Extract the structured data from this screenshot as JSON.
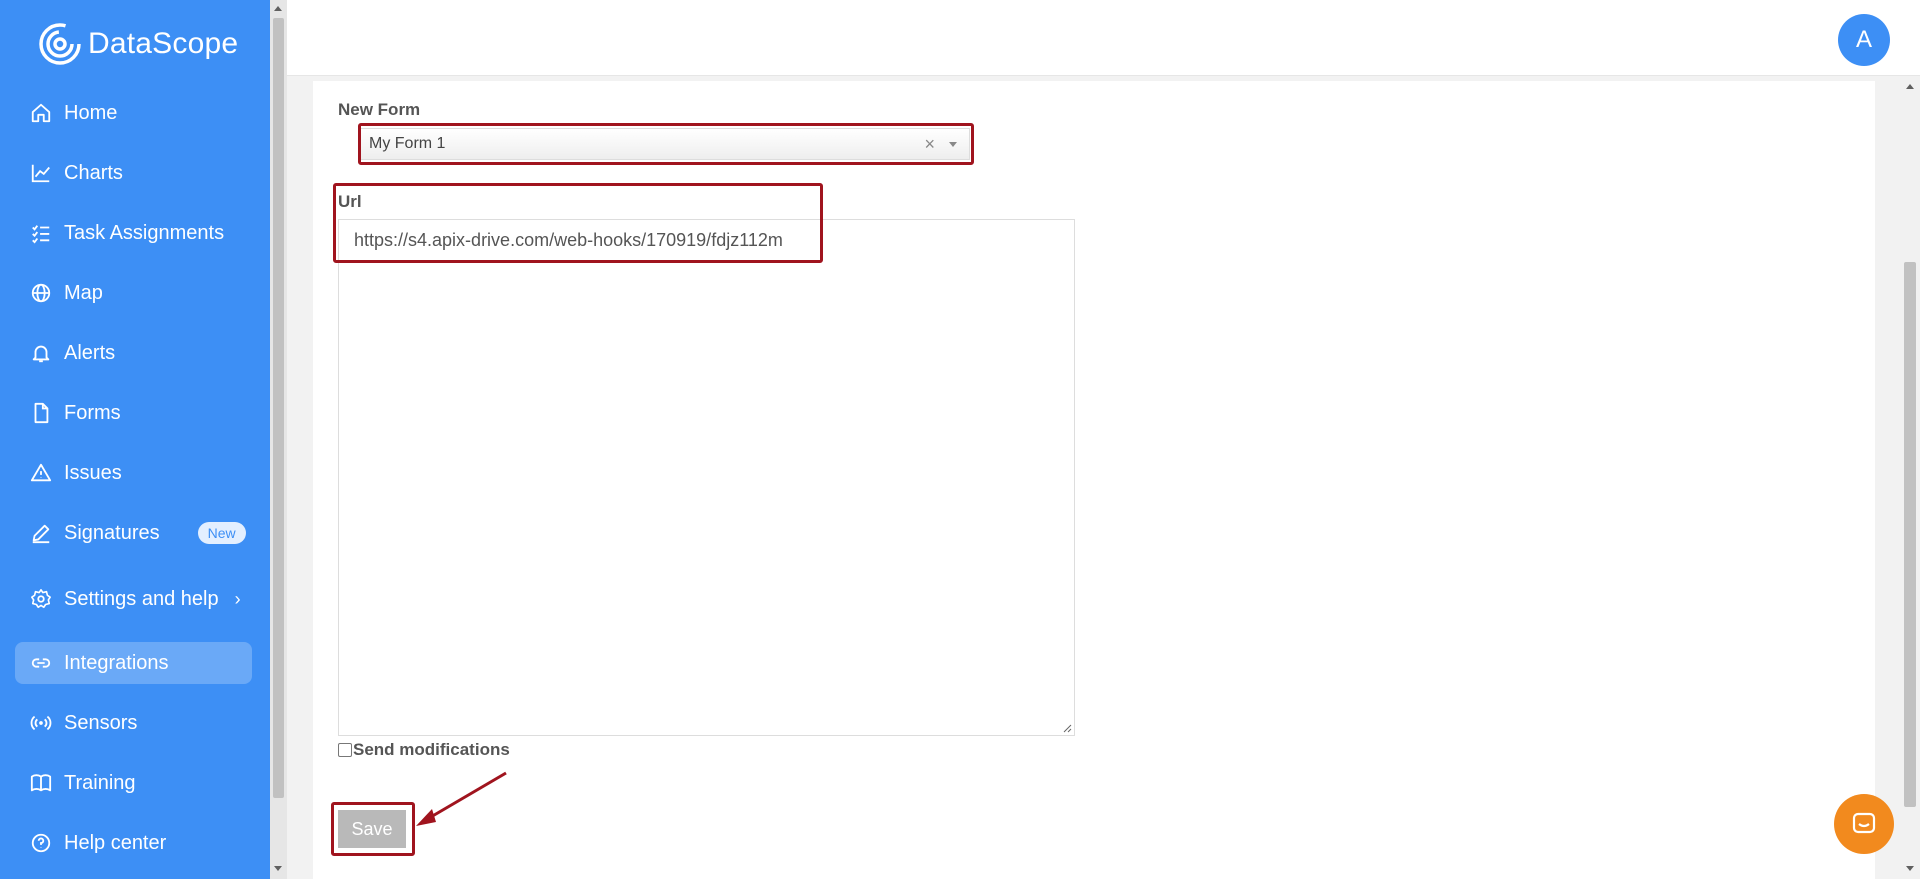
{
  "app": {
    "name": "DataScope",
    "brand_color": "#3d8ff5"
  },
  "sidebar": {
    "items": [
      {
        "label": "Home",
        "icon": "home-icon"
      },
      {
        "label": "Charts",
        "icon": "chart-line-icon"
      },
      {
        "label": "Task Assignments",
        "icon": "checklist-icon"
      },
      {
        "label": "Map",
        "icon": "globe-icon"
      },
      {
        "label": "Alerts",
        "icon": "bell-icon"
      },
      {
        "label": "Forms",
        "icon": "file-icon"
      },
      {
        "label": "Issues",
        "icon": "warning-icon"
      },
      {
        "label": "Signatures",
        "icon": "pen-icon",
        "badge": "New"
      },
      {
        "label": "Settings and help",
        "icon": "gear-icon"
      },
      {
        "label": "Integrations",
        "icon": "link-icon",
        "active": true
      },
      {
        "label": "Sensors",
        "icon": "sensor-icon"
      },
      {
        "label": "Training",
        "icon": "book-icon"
      },
      {
        "label": "Help center",
        "icon": "help-circle-icon"
      }
    ]
  },
  "header": {
    "avatar_letter": "A"
  },
  "form": {
    "new_form_label": "New Form",
    "selected_form": "My Form 1",
    "url_label": "Url",
    "url_value": "https://s4.apix-drive.com/web-hooks/170919/fdjz112m",
    "send_modifications_label": "Send modifications",
    "send_modifications_checked": false,
    "save_label": "Save"
  },
  "colors": {
    "highlight": "#a0141e",
    "chat": "#f28a1e"
  }
}
